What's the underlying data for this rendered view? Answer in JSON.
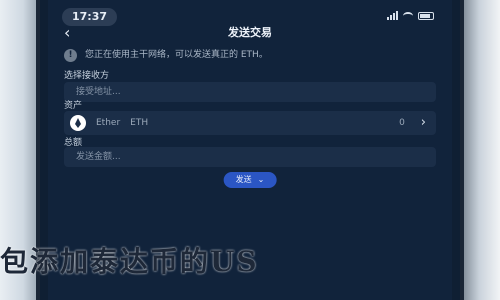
{
  "status_bar": {
    "time": "17:37"
  },
  "nav": {
    "back_icon": "chevron-left-icon",
    "title": "发送交易"
  },
  "notice": {
    "icon": "warning-icon",
    "text": "您正在使用主干网络，可以发送真正的 ETH。"
  },
  "form": {
    "address_label": "选择接收方",
    "address_placeholder": "接受地址...",
    "asset_label": "资产",
    "asset": {
      "name": "Ether",
      "symbol": "ETH",
      "balance": "0"
    },
    "amount_label": "总额",
    "amount_placeholder": "发送金额..."
  },
  "send_button": {
    "label": "发送"
  },
  "overlay_banner": {
    "text": "包添加泰达币的US"
  }
}
